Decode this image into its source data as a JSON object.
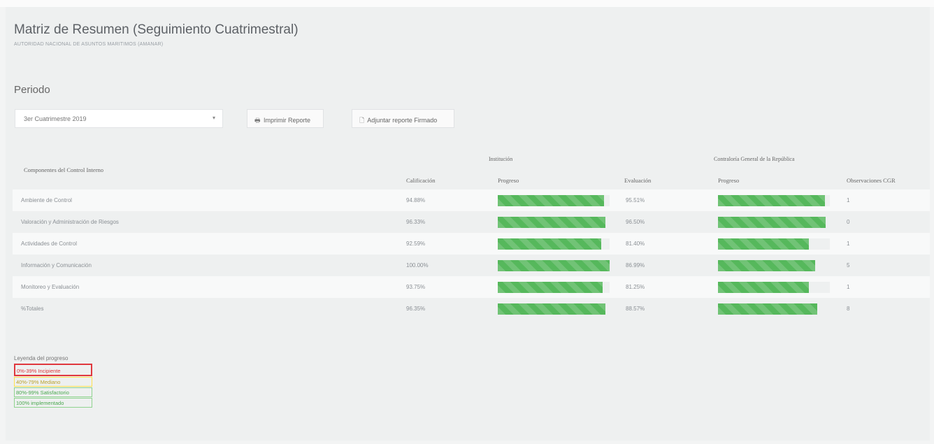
{
  "page": {
    "title": "Matriz de Resumen (Seguimiento Cuatrimestral)",
    "subtitle": "AUTORIDAD NACIONAL DE ASUNTOS MARITIMOS (AMANAR)",
    "period_label": "Periodo"
  },
  "controls": {
    "period_select": "3er Cuatrimestre 2019",
    "print_button": "Imprimir Reporte",
    "attach_button": "Adjuntar reporte Firmado"
  },
  "table": {
    "group_institucion": "Institución",
    "group_contraloria": "Contraloría General de la República",
    "headers": {
      "componentes": "Componentes del Control Interno",
      "calificacion": "Calificación",
      "progreso_inst": "Progreso",
      "evaluacion": "Evaluación",
      "progreso_cgr": "Progreso",
      "observaciones": "Observaciones CGR"
    },
    "rows": [
      {
        "componente": "Ambiente de Control",
        "calificacion": "94.88%",
        "progreso_inst": 0.9488,
        "evaluacion": "95.51%",
        "progreso_cgr": 0.9551,
        "observaciones": "1"
      },
      {
        "componente": "Valoración y Administración de Riesgos",
        "calificacion": "96.33%",
        "progreso_inst": 0.9633,
        "evaluacion": "96.50%",
        "progreso_cgr": 0.965,
        "observaciones": "0"
      },
      {
        "componente": "Actividades de Control",
        "calificacion": "92.59%",
        "progreso_inst": 0.9259,
        "evaluacion": "81.40%",
        "progreso_cgr": 0.814,
        "observaciones": "1"
      },
      {
        "componente": "Información y Comunicación",
        "calificacion": "100.00%",
        "progreso_inst": 1.0,
        "evaluacion": "86.99%",
        "progreso_cgr": 0.8699,
        "observaciones": "5"
      },
      {
        "componente": "Monitoreo y Evaluación",
        "calificacion": "93.75%",
        "progreso_inst": 0.9375,
        "evaluacion": "81.25%",
        "progreso_cgr": 0.8125,
        "observaciones": "1"
      },
      {
        "componente": "%Totales",
        "calificacion": "96.35%",
        "progreso_inst": 0.9635,
        "evaluacion": "88.57%",
        "progreso_cgr": 0.8857,
        "observaciones": "8"
      }
    ]
  },
  "legend": {
    "title": "Leyenda del progreso",
    "items": [
      "0%-39% Incipiente",
      "40%-79% Mediano",
      "80%-99% Satisfactorio",
      "100% implementado"
    ],
    "colors": [
      "#e0383e",
      "#ffe24d",
      "#4aa84f",
      "#4aa84f"
    ]
  },
  "progress_color": "#56b85c"
}
